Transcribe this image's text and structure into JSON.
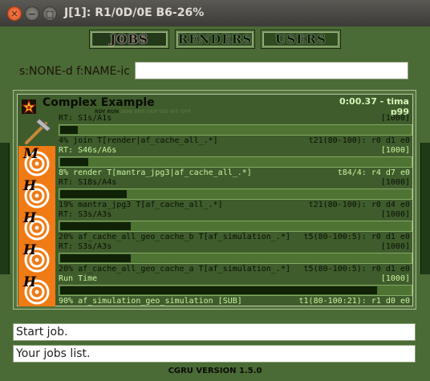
{
  "window": {
    "title": "J[1]: R1/0D/0E B6-26%",
    "close_glyph": "✕",
    "min_glyph": "−",
    "max_glyph": "□"
  },
  "tabs": [
    {
      "label": "JOBS",
      "active": true
    },
    {
      "label": "RENDERS",
      "active": false
    },
    {
      "label": "USERS",
      "active": false
    }
  ],
  "filter": {
    "label": "s:NONE-d f:NAME-ic",
    "value": ""
  },
  "job": {
    "name": "Complex Example",
    "states_active": "RDY RUN",
    "states_dim": "DON ERR SKP WD WT OFF",
    "time": "0:00.37 - tima",
    "priority": "p99",
    "blocks": [
      {
        "icon": "hammer-icon",
        "letter": "",
        "head_left": "RT: S1s/A1s",
        "head_right": "[1000]",
        "head_highlight": false,
        "progress": 0.05,
        "foot_left": "4% join T[render|af_cache_all_.*]",
        "foot_right": "t21(80-100): r0 d1 e0",
        "foot_highlight": false
      },
      {
        "icon": "swirl-icon",
        "letter": "M",
        "head_left": "RT: S46s/A6s",
        "head_right": "[1000]",
        "head_highlight": true,
        "progress": 0.08,
        "foot_left": "8% render T[mantra_jpg3|af_cache_all_.*]",
        "foot_right": "t84/4: r4 d7 e0",
        "foot_highlight": true
      },
      {
        "icon": "swirl-icon",
        "letter": "H",
        "head_left": "RT: S18s/A4s",
        "head_right": "[1000]",
        "head_highlight": false,
        "progress": 0.19,
        "foot_left": "19% mantra_jpg3 T[af_cache_all_.*]",
        "foot_right": "t21(80-100): r0 d4 e0",
        "foot_highlight": false
      },
      {
        "icon": "swirl-icon",
        "letter": "H",
        "head_left": "RT: S3s/A3s",
        "head_right": "[1000]",
        "head_highlight": false,
        "progress": 0.2,
        "foot_left": "20% af_cache_all_geo_cache_b T[af_simulation_.*]",
        "foot_right": "t5(80-100:5): r0 d1 e0",
        "foot_highlight": false
      },
      {
        "icon": "swirl-icon",
        "letter": "H",
        "head_left": "RT: S3s/A3s",
        "head_right": "[1000]",
        "head_highlight": false,
        "progress": 0.2,
        "foot_left": "20% af_cache_all_geo_cache_a T[af_simulation_.*]",
        "foot_right": "t5(80-100:5): r0 d1 e0",
        "foot_highlight": false
      },
      {
        "icon": "swirl-icon",
        "letter": "H",
        "head_left": "Run Time",
        "head_right": "[1000]",
        "head_highlight": true,
        "progress": 0.9,
        "foot_left": "90% af_simulation_geo_simulation [SUB]",
        "foot_right": "t1(80-100:21): r1 d0 e0",
        "foot_highlight": true
      }
    ]
  },
  "status_line_1": "Start job.",
  "status_line_2": "Your jobs list.",
  "version": "CGRU VERSION 1.5.0",
  "colors": {
    "background": "#4a6a36",
    "block_orange": "#f07a14",
    "highlight_text": "#c8f5a0"
  }
}
